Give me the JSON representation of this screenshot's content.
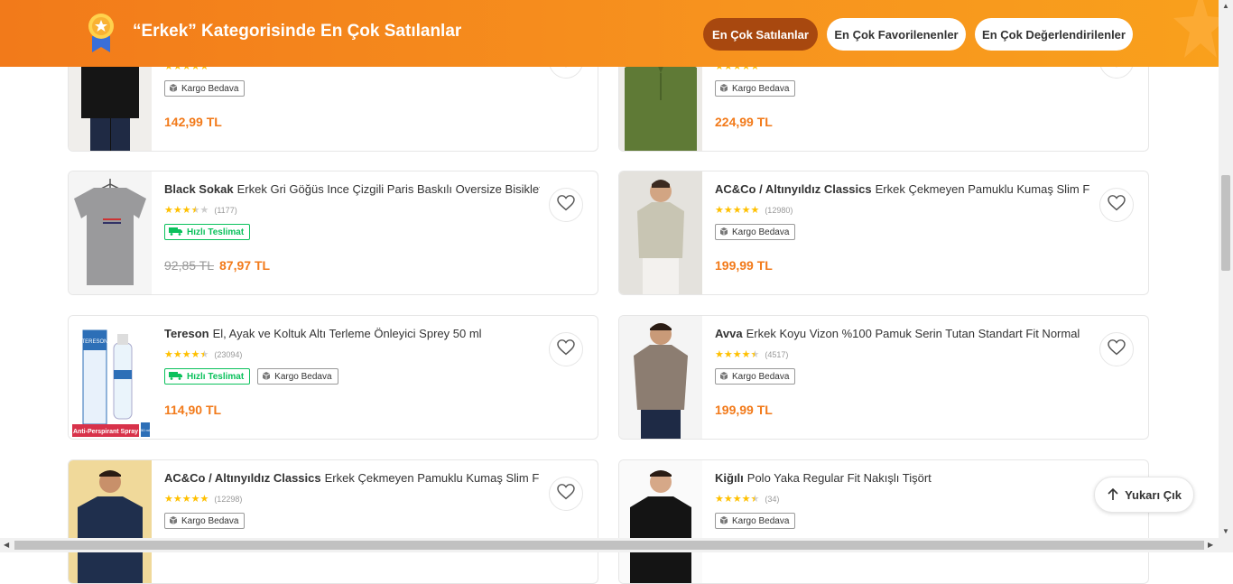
{
  "header": {
    "title": "“Erkek” Kategorisinde En Çok Satılanlar",
    "tabs": [
      {
        "label": "En Çok Satılanlar",
        "active": true
      },
      {
        "label": "En Çok Favorilenenler",
        "active": false
      },
      {
        "label": "En Çok Değerlendirilenler",
        "active": false
      }
    ]
  },
  "products": [
    {
      "brand": "",
      "name": "",
      "rating": 5,
      "reviews": "",
      "fast": false,
      "cargo": "Kargo Bedava",
      "old_price": "",
      "price": "142,99 TL"
    },
    {
      "brand": "",
      "name": "",
      "rating": 5,
      "reviews": "",
      "fast": false,
      "cargo": "Kargo Bedava",
      "old_price": "",
      "price": "224,99 TL"
    },
    {
      "brand": "Black Sokak",
      "name": "Erkek Gri Göğüs Ince Çizgili Paris Baskılı Oversize Bisiklet",
      "rating": 3.5,
      "reviews": "(1177)",
      "fast": "Hızlı Teslimat",
      "cargo": "",
      "old_price": "92,85 TL",
      "price": "87,97 TL"
    },
    {
      "brand": "AC&Co / Altınyıldız Classics",
      "name": "Erkek Çekmeyen Pamuklu Kumaş Slim Fit",
      "rating": 5,
      "reviews": "(12980)",
      "fast": false,
      "cargo": "Kargo Bedava",
      "old_price": "",
      "price": "199,99 TL"
    },
    {
      "brand": "Tereson",
      "name": "El, Ayak ve Koltuk Altı Terleme Önleyici Sprey 50 ml",
      "rating": 4.5,
      "reviews": "(23094)",
      "fast": "Hızlı Teslimat",
      "cargo": "Kargo Bedava",
      "old_price": "",
      "price": "114,90 TL"
    },
    {
      "brand": "Avva",
      "name": "Erkek Koyu Vizon %100 Pamuk Serin Tutan Standart Fit Normal",
      "rating": 4.5,
      "reviews": "(4517)",
      "fast": false,
      "cargo": "Kargo Bedava",
      "old_price": "",
      "price": "199,99 TL"
    },
    {
      "brand": "AC&Co / Altınyıldız Classics",
      "name": "Erkek Çekmeyen Pamuklu Kumaş Slim Fit",
      "rating": 5,
      "reviews": "(12298)",
      "fast": false,
      "cargo": "Kargo Bedava",
      "old_price": "",
      "price": ""
    },
    {
      "brand": "Kiğılı",
      "name": "Polo Yaka Regular Fit Nakışlı Tişört",
      "rating": 4.5,
      "reviews": "(34)",
      "fast": false,
      "cargo": "Kargo Bedava",
      "old_price": "",
      "price": ""
    }
  ],
  "tereson_box": {
    "brand": "TERESON",
    "caption": "Anti-Perspirant Spray",
    "size": "50 ml"
  },
  "scroll_up": {
    "label": "Yukarı Çık"
  },
  "colors": {
    "accent": "#f27a1a",
    "active_tab": "#a8480f",
    "fast": "#0bc15c",
    "star": "#ffc000"
  }
}
